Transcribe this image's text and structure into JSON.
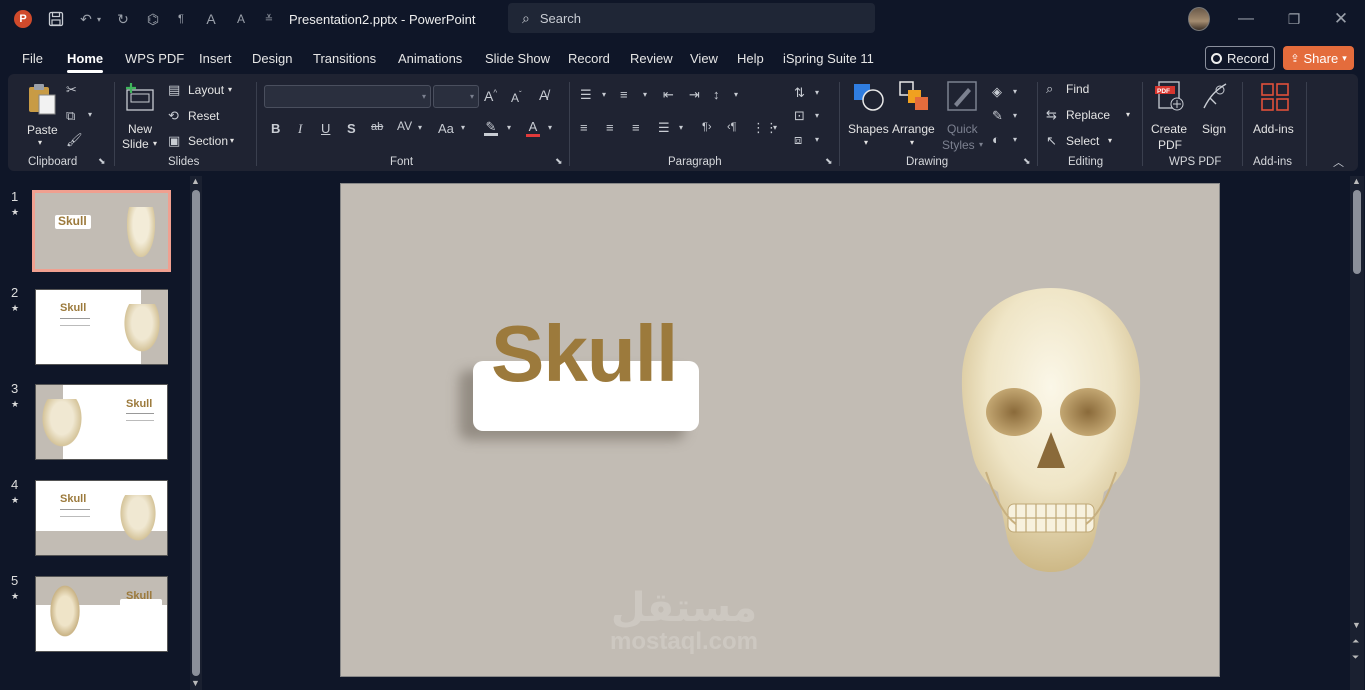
{
  "app": {
    "file_name": "Presentation2.pptx",
    "separator": " - ",
    "app_name": "PowerPoint"
  },
  "search": {
    "placeholder": "Search"
  },
  "tabs": [
    "File",
    "Home",
    "WPS PDF",
    "Insert",
    "Design",
    "Transitions",
    "Animations",
    "Slide Show",
    "Record",
    "Review",
    "View",
    "Help",
    "iSpring Suite 11"
  ],
  "active_tab": "Home",
  "header_buttons": {
    "record": "Record",
    "share": "Share"
  },
  "ribbon": {
    "clipboard": {
      "label": "Clipboard",
      "paste": "Paste"
    },
    "slides": {
      "label": "Slides",
      "new_slide_1": "New",
      "new_slide_2": "Slide",
      "layout": "Layout",
      "reset": "Reset",
      "section": "Section"
    },
    "font": {
      "label": "Font",
      "family": "",
      "size": ""
    },
    "paragraph": {
      "label": "Paragraph"
    },
    "drawing": {
      "label": "Drawing",
      "shapes": "Shapes",
      "arrange": "Arrange",
      "quick_styles_1": "Quick",
      "quick_styles_2": "Styles"
    },
    "editing": {
      "label": "Editing",
      "find": "Find",
      "replace": "Replace",
      "select": "Select"
    },
    "wps_pdf": {
      "label": "WPS PDF",
      "create_pdf_1": "Create",
      "create_pdf_2": "PDF",
      "sign": "Sign"
    },
    "addins": {
      "label": "Add-ins",
      "addins_btn": "Add-ins"
    }
  },
  "thumbnails": [
    {
      "num": "1",
      "title": "Skull"
    },
    {
      "num": "2",
      "title": "Skull"
    },
    {
      "num": "3",
      "title": "Skull"
    },
    {
      "num": "4",
      "title": "Skull"
    },
    {
      "num": "5",
      "title": "Skull"
    }
  ],
  "slide": {
    "title": "Skull",
    "watermark_1": "مستقل",
    "watermark_2": "mostaql.com"
  },
  "colors": {
    "accent_orange": "#e46c3c",
    "title_brown": "#9c7a3c",
    "slide_bg": "#c2bcb4"
  }
}
